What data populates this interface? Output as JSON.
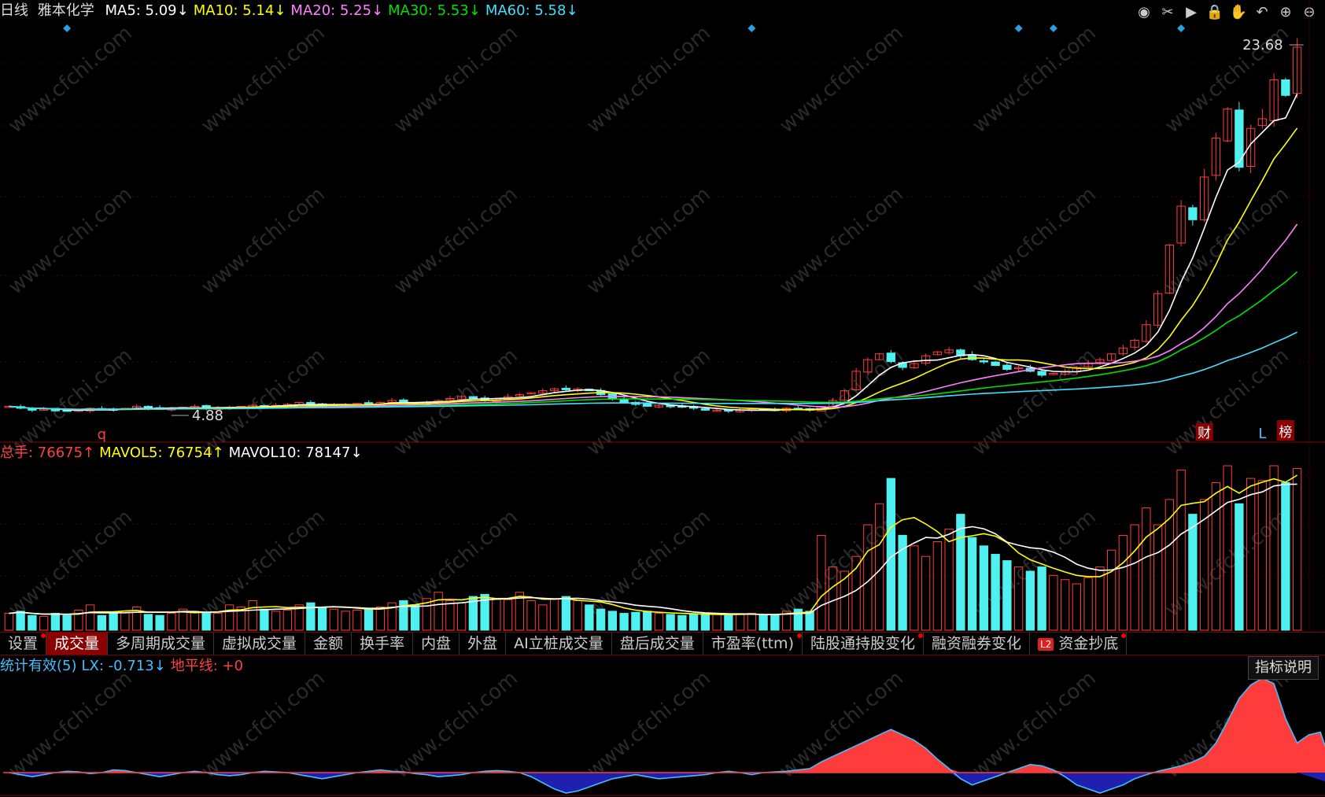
{
  "header": {
    "period": "日线",
    "stock": "雅本化学",
    "ma_items": [
      {
        "label": "MA5: 5.09",
        "arrow": "↓",
        "color": "#ffffff"
      },
      {
        "label": "MA10: 5.14",
        "arrow": "↓",
        "color": "#ffff00"
      },
      {
        "label": "MA20: 5.25",
        "arrow": "↓",
        "color": "#ff80ff"
      },
      {
        "label": "MA30: 5.53",
        "arrow": "↓",
        "color": "#00e000"
      },
      {
        "label": "MA60: 5.58",
        "arrow": "↓",
        "color": "#40e0ff"
      }
    ]
  },
  "toolbar": {
    "icons": [
      "eye-icon",
      "scissors-icon",
      "play-icon",
      "lock-icon",
      "hand-icon",
      "undo-icon",
      "zoom-in-icon",
      "zoom-out-icon"
    ],
    "glyphs": [
      "◉",
      "✂",
      "▶",
      "🔒",
      "✋",
      "↶",
      "⊕",
      "⊖"
    ]
  },
  "price_panel": {
    "high_label": "23.68",
    "low_label": "4.88",
    "markers": {
      "q": "q",
      "cai": "财",
      "L": "L",
      "bang": "榜"
    }
  },
  "volume_panel": {
    "legend": [
      {
        "label": "总手: 76675",
        "arrow": "↑",
        "color": "#ff4040"
      },
      {
        "label": "MAVOL5: 76754",
        "arrow": "↑",
        "color": "#ffff00"
      },
      {
        "label": "MAVOL10: 78147",
        "arrow": "↓",
        "color": "#ffffff"
      }
    ]
  },
  "tabs": [
    {
      "label": "设置",
      "active": false,
      "dot": true
    },
    {
      "label": "成交量",
      "active": true,
      "dot": false
    },
    {
      "label": "多周期成交量",
      "active": false,
      "dot": false
    },
    {
      "label": "虚拟成交量",
      "active": false,
      "dot": false
    },
    {
      "label": "金额",
      "active": false,
      "dot": false
    },
    {
      "label": "换手率",
      "active": false,
      "dot": false
    },
    {
      "label": "内盘",
      "active": false,
      "dot": false
    },
    {
      "label": "外盘",
      "active": false,
      "dot": false
    },
    {
      "label": "AI立桩成交量",
      "active": false,
      "dot": false
    },
    {
      "label": "盘后成交量",
      "active": false,
      "dot": false
    },
    {
      "label": "市盈率(ttm)",
      "active": false,
      "dot": true
    },
    {
      "label": "陆股通持股变化",
      "active": false,
      "dot": true
    },
    {
      "label": "融资融券变化",
      "active": false,
      "dot": false
    },
    {
      "label": "资金抄底",
      "active": false,
      "dot": true,
      "badge": "L2"
    }
  ],
  "indicator_panel": {
    "legend": [
      {
        "label": "统计有效(5)",
        "color": "#40c0ff"
      },
      {
        "label": "LX: -0.713",
        "arrow": "↓",
        "color": "#40c0ff"
      },
      {
        "label": "地平线: +0",
        "color": "#ff4040"
      }
    ],
    "explain_label": "指标说明"
  },
  "chart_data": [
    {
      "type": "candlestick",
      "title": "",
      "price_range": [
        4.88,
        23.68
      ],
      "ma_latest": {
        "MA5": 5.09,
        "MA10": 5.14,
        "MA20": 5.25,
        "MA30": 5.53,
        "MA60": 5.58
      },
      "series": [
        {
          "name": "MA5",
          "color": "#ffffff"
        },
        {
          "name": "MA10",
          "color": "#ffff00"
        },
        {
          "name": "MA20",
          "color": "#ff80ff"
        },
        {
          "name": "MA30",
          "color": "#00e000"
        },
        {
          "name": "MA60",
          "color": "#40e0ff"
        }
      ],
      "candles_close": [
        5.2,
        5.1,
        5.0,
        5.05,
        5.0,
        4.95,
        5.0,
        5.1,
        5.05,
        5.0,
        5.1,
        5.2,
        5.1,
        5.05,
        5.1,
        5.15,
        5.2,
        5.1,
        5.1,
        5.15,
        5.2,
        5.25,
        5.2,
        5.25,
        5.3,
        5.4,
        5.3,
        5.2,
        5.25,
        5.3,
        5.35,
        5.3,
        5.4,
        5.5,
        5.4,
        5.35,
        5.4,
        5.5,
        5.6,
        5.7,
        5.6,
        5.5,
        5.6,
        5.7,
        5.8,
        5.9,
        6.0,
        6.1,
        6.05,
        6.1,
        6.0,
        5.8,
        5.6,
        5.4,
        5.3,
        5.2,
        5.25,
        5.2,
        5.15,
        5.1,
        5.0,
        5.0,
        4.95,
        5.0,
        5.05,
        5.0,
        5.0,
        5.1,
        5.05,
        5.0,
        5.2,
        5.5,
        6.0,
        7.0,
        7.6,
        7.9,
        7.5,
        7.2,
        7.4,
        7.8,
        8.0,
        8.1,
        7.8,
        7.6,
        7.5,
        7.3,
        7.1,
        7.2,
        7.0,
        6.8,
        6.9,
        7.0,
        7.2,
        7.4,
        7.6,
        7.9,
        8.2,
        8.6,
        9.4,
        11.0,
        13.5,
        15.5,
        14.8,
        17.0,
        19.0,
        20.5,
        17.5,
        19.5,
        20.0,
        22.0,
        21.2,
        23.68
      ],
      "annotations": [
        "q",
        "财",
        "L",
        "榜"
      ]
    },
    {
      "type": "bar",
      "title": "",
      "series_names": [
        "总手",
        "MAVOL5",
        "MAVOL10"
      ],
      "latest": {
        "总手": 76675,
        "MAVOL5": 76754,
        "MAVOL10": 78147
      },
      "values": [
        8000,
        9000,
        7000,
        6500,
        8000,
        7000,
        9500,
        12000,
        7000,
        8000,
        9000,
        11000,
        7500,
        7000,
        8000,
        10000,
        9000,
        8500,
        8000,
        12000,
        11000,
        14000,
        10000,
        9000,
        9500,
        12000,
        13000,
        11000,
        10000,
        9000,
        9500,
        10500,
        11000,
        13000,
        14000,
        12000,
        15000,
        18000,
        14000,
        13000,
        16000,
        17000,
        15000,
        14500,
        18000,
        14000,
        12000,
        15000,
        16000,
        14000,
        12000,
        10000,
        9000,
        8000,
        8500,
        9000,
        8000,
        7500,
        7000,
        7500,
        8000,
        7500,
        7000,
        7500,
        8000,
        7000,
        7500,
        9000,
        10000,
        9000,
        45000,
        30000,
        28000,
        35000,
        50000,
        60000,
        72000,
        45000,
        40000,
        35000,
        42000,
        48000,
        55000,
        44000,
        40000,
        36000,
        33000,
        30000,
        28000,
        30000,
        26000,
        24000,
        22000,
        25000,
        30000,
        38000,
        45000,
        50000,
        58000,
        50000,
        62000,
        76000,
        55000,
        62000,
        70000,
        78000,
        60000,
        72000,
        71000,
        78000,
        70000,
        76675
      ]
    },
    {
      "type": "area",
      "title": "",
      "series_names": [
        "LX",
        "地平线"
      ],
      "latest": {
        "LX": -0.713,
        "地平线": 0
      },
      "values": [
        0.0,
        -0.1,
        -0.2,
        -0.1,
        0.0,
        0.1,
        0.05,
        -0.05,
        0.0,
        0.2,
        0.15,
        0.0,
        -0.1,
        -0.2,
        -0.1,
        0.0,
        0.1,
        0.0,
        -0.1,
        -0.15,
        -0.1,
        0.0,
        0.1,
        0.05,
        0.0,
        -0.1,
        -0.2,
        -0.3,
        -0.2,
        -0.1,
        0.0,
        0.1,
        0.2,
        0.1,
        0.05,
        -0.05,
        -0.1,
        -0.2,
        -0.15,
        -0.1,
        0.0,
        0.1,
        0.15,
        0.1,
        0.0,
        -0.2,
        -0.5,
        -0.8,
        -1.0,
        -0.9,
        -0.7,
        -0.5,
        -0.3,
        -0.2,
        -0.1,
        -0.2,
        -0.3,
        -0.25,
        -0.2,
        -0.15,
        -0.1,
        0.0,
        0.1,
        0.0,
        -0.1,
        0.0,
        0.05,
        0.1,
        0.2,
        0.3,
        0.8,
        1.2,
        1.6,
        2.0,
        2.4,
        2.8,
        3.2,
        2.8,
        2.4,
        1.8,
        1.0,
        0.3,
        -0.3,
        -0.6,
        -0.4,
        -0.2,
        0.0,
        0.3,
        0.6,
        0.5,
        0.2,
        -0.2,
        -0.6,
        -0.8,
        -1.0,
        -0.8,
        -0.6,
        -0.3,
        -0.1,
        0.1,
        0.3,
        0.5,
        0.8,
        1.2,
        2.2,
        3.8,
        5.5,
        6.5,
        7.0,
        6.6,
        4.0,
        2.2,
        2.8,
        3.0,
        0.5,
        -0.713
      ]
    }
  ]
}
